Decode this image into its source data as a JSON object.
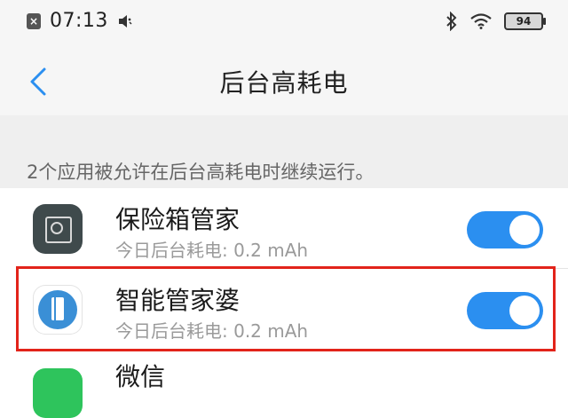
{
  "status_bar": {
    "time": "07:13",
    "battery": "94",
    "icons": [
      "notification-x-icon",
      "mute-icon",
      "bluetooth-icon",
      "wifi-icon",
      "battery-icon"
    ]
  },
  "nav": {
    "back_icon": "chevron-left-icon",
    "title": "后台高耗电"
  },
  "description": "2个应用被允许在后台高耗电时继续运行。",
  "apps": [
    {
      "name": "保险箱管家",
      "usage": "今日后台耗电: 0.2 mAh",
      "allowed": true,
      "icon": "safe-icon"
    },
    {
      "name": "智能管家婆",
      "usage": "今日后台耗电: 0.2 mAh",
      "allowed": true,
      "icon": "phone-book-icon"
    },
    {
      "name": "微信",
      "icon": "wechat-icon"
    }
  ],
  "colors": {
    "toggle_on": "#2b8ff0",
    "highlight_border": "#e2231a",
    "back_arrow": "#2b8ff0"
  }
}
